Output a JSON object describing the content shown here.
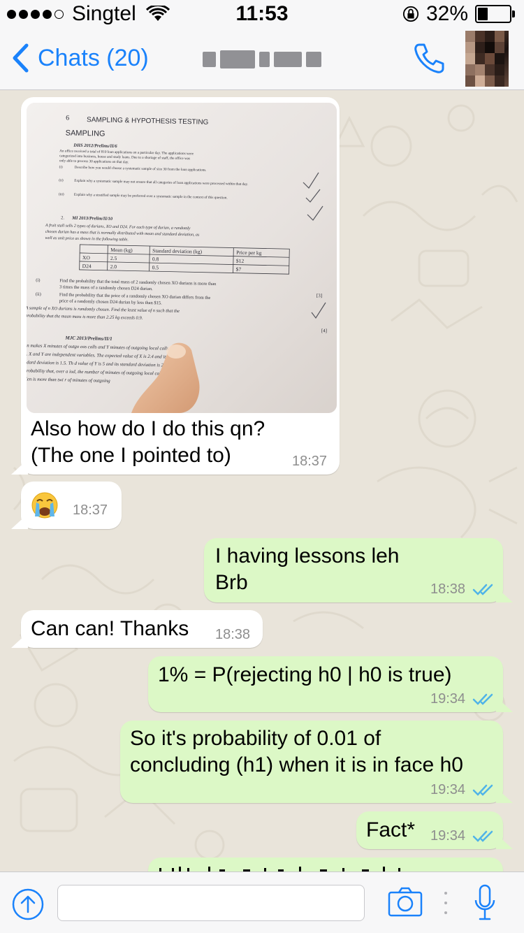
{
  "status_bar": {
    "carrier": "Singtel",
    "time": "11:53",
    "battery": "32%",
    "battery_level": 0.32
  },
  "nav": {
    "back_label": "Chats (20)"
  },
  "messages": [
    {
      "type": "image_text",
      "direction": "incoming",
      "text": "Also how do I do this qn?\n(The one I pointed to)",
      "time": "18:37"
    },
    {
      "type": "emoji",
      "direction": "incoming",
      "time": "18:37"
    },
    {
      "direction": "outgoing",
      "text": "I having lessons leh\nBrb",
      "time": "18:38"
    },
    {
      "direction": "incoming",
      "text": "Can can! Thanks",
      "time": "18:38"
    },
    {
      "direction": "outgoing",
      "text": "1% = P(rejecting h0 | h0 is true)",
      "time": "19:34"
    },
    {
      "direction": "outgoing",
      "text": "So it's probability of 0.01 of\nconcluding (h1) when it is in face h0",
      "time": "19:34"
    },
    {
      "direction": "outgoing",
      "text": "Fact*",
      "time": "19:34"
    }
  ],
  "photo": {
    "page_number": "6",
    "chapter_title": "SAMPLING & HYPOTHESIS TESTING",
    "section": "SAMPLING",
    "q1_source": "DHS 2012/Prelims/II/6",
    "q1_line1": "An office received a total of 810 loan applications on a particular day. The applications were",
    "q1_line2": "categorized into business, house and study loans. Due to a shortage of staff, the office was",
    "q1_line3": "only able to process 30 applications on that day.",
    "q1_i": "Describe how you would choose a systematic sample of size 30 from the loan applications.",
    "q1_ii": "Explain why a systematic sample may not ensure that all categories of loan applications were processed within that day.",
    "q1_iii": "Explain why a stratified sample may be preferred over a systematic sample in the context of this question.",
    "q2_source": "MI 2013/Prelim/II/10",
    "q2_line1": "A fruit stall sells 2 types of durians, XO and D24. For each type of durian, a randomly",
    "q2_line2": "chosen durian has a mass that is normally distributed with mean and standard deviation, as",
    "q2_line3": "well as unit price as shown in the following table.",
    "table_headers": [
      "",
      "Mean (kg)",
      "Standard deviation (kg)",
      "Price per kg"
    ],
    "table_rows": [
      [
        "XO",
        "2.5",
        "0.8",
        "$12"
      ],
      [
        "D24",
        "2.0",
        "0.5",
        "$7"
      ]
    ],
    "q2_i_a": "Find the probability that the total mass of 2 randomly chosen XO durians is more than",
    "q2_i_b": "3 times the mass of a randomly chosen D24 durian.",
    "q2_ii_a": "Find the probability that the price of a randomly chosen XO durian differs from the",
    "q2_ii_b": "price of a randomly chosen D24 durian by less than $15.",
    "q2_iii_a": "A sample of n XO durians is randomly chosen. Find the least value of n such that the",
    "q2_iii_b": "probability that the mean mass is more than 2.25 kg exceeds 0.9.",
    "q3_source": "MJC 2013/Prelims/II/1",
    "q3_line1": "en makes X minutes of outgo     eas calls and Y minutes of outgoing local calls in a",
    "q3_line2": "y. X and Y are independent      variables. The expected value of X is 2.4 and its",
    "q3_line3": "ndard deviation is 1.5. Th      d value of Y is 5 and its standard deviation is 2.5. Fin",
    "q3_line4": "probability that, over a       iod, the number of minutes of outgoing local calls ma",
    "q3_line5": "Ken is more than twi          r of minutes of outgoing",
    "marks": [
      "[3]",
      "[4]"
    ]
  },
  "icons": {
    "signal": "signal-dots-icon",
    "wifi": "wifi-icon",
    "lock": "orientation-lock-icon",
    "back": "chevron-left-icon",
    "call": "phone-icon",
    "share": "share-up-arrow-icon",
    "camera": "camera-icon",
    "mic": "microphone-icon",
    "read": "double-check-icon",
    "emoji": "crying-face-emoji"
  },
  "colors": {
    "accent": "#1a82fb",
    "outgoing_bubble": "#dcf8c6",
    "incoming_bubble": "#ffffff",
    "chat_background": "#e9e4da",
    "read_ticks": "#4fb3e8"
  }
}
